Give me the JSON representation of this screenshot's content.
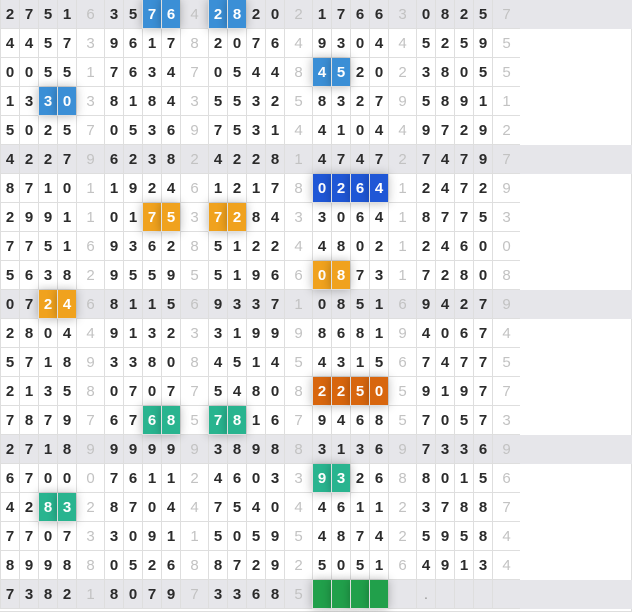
{
  "grid": {
    "rows": [
      {
        "cells": [
          "2",
          "7",
          "5",
          "1",
          "6",
          "3",
          "5",
          "7",
          "6",
          "4",
          "2",
          "8",
          "2",
          "0",
          "2",
          "1",
          "7",
          "6",
          "6",
          "3",
          "0",
          "8",
          "2",
          "5",
          "7"
        ],
        "alt": true
      },
      {
        "cells": [
          "4",
          "4",
          "5",
          "7",
          "3",
          "9",
          "6",
          "1",
          "7",
          "8",
          "2",
          "0",
          "7",
          "6",
          "4",
          "9",
          "3",
          "0",
          "4",
          "4",
          "5",
          "2",
          "5",
          "9",
          "5"
        ],
        "alt": false
      },
      {
        "cells": [
          "0",
          "0",
          "5",
          "5",
          "1",
          "7",
          "6",
          "3",
          "4",
          "7",
          "0",
          "5",
          "4",
          "4",
          "8",
          "4",
          "5",
          "2",
          "0",
          "2",
          "3",
          "8",
          "0",
          "5",
          "5"
        ],
        "alt": false
      },
      {
        "cells": [
          "1",
          "3",
          "3",
          "0",
          "3",
          "8",
          "1",
          "8",
          "4",
          "3",
          "5",
          "5",
          "3",
          "2",
          "5",
          "8",
          "3",
          "2",
          "7",
          "9",
          "5",
          "8",
          "9",
          "1",
          "1"
        ],
        "alt": false
      },
      {
        "cells": [
          "5",
          "0",
          "2",
          "5",
          "7",
          "0",
          "5",
          "3",
          "6",
          "9",
          "7",
          "5",
          "3",
          "1",
          "4",
          "4",
          "1",
          "0",
          "4",
          "4",
          "9",
          "7",
          "2",
          "9",
          "2"
        ],
        "alt": false
      },
      {
        "cells": [
          "4",
          "2",
          "2",
          "7",
          "9",
          "6",
          "2",
          "3",
          "8",
          "2",
          "4",
          "2",
          "2",
          "8",
          "1",
          "4",
          "7",
          "4",
          "7",
          "2",
          "7",
          "4",
          "7",
          "9",
          "7"
        ],
        "alt": true
      },
      {
        "cells": [
          "8",
          "7",
          "1",
          "0",
          "1",
          "1",
          "9",
          "2",
          "4",
          "6",
          "1",
          "2",
          "1",
          "7",
          "8",
          "0",
          "2",
          "6",
          "4",
          "1",
          "2",
          "4",
          "7",
          "2",
          "9"
        ],
        "alt": false
      },
      {
        "cells": [
          "2",
          "9",
          "9",
          "1",
          "1",
          "0",
          "1",
          "7",
          "5",
          "3",
          "7",
          "2",
          "8",
          "4",
          "3",
          "3",
          "0",
          "6",
          "4",
          "1",
          "8",
          "7",
          "7",
          "5",
          "3"
        ],
        "alt": false
      },
      {
        "cells": [
          "7",
          "7",
          "5",
          "1",
          "6",
          "9",
          "3",
          "6",
          "2",
          "8",
          "5",
          "1",
          "2",
          "2",
          "4",
          "4",
          "8",
          "0",
          "2",
          "1",
          "2",
          "4",
          "6",
          "0",
          "0"
        ],
        "alt": false
      },
      {
        "cells": [
          "5",
          "6",
          "3",
          "8",
          "2",
          "9",
          "5",
          "5",
          "9",
          "5",
          "5",
          "1",
          "9",
          "6",
          "6",
          "0",
          "8",
          "7",
          "3",
          "1",
          "7",
          "2",
          "8",
          "0",
          "8"
        ],
        "alt": false
      },
      {
        "cells": [
          "0",
          "7",
          "2",
          "4",
          "6",
          "8",
          "1",
          "1",
          "5",
          "6",
          "9",
          "3",
          "3",
          "7",
          "1",
          "0",
          "8",
          "5",
          "1",
          "6",
          "9",
          "4",
          "2",
          "7",
          "9"
        ],
        "alt": true
      },
      {
        "cells": [
          "2",
          "8",
          "0",
          "4",
          "4",
          "9",
          "1",
          "3",
          "2",
          "3",
          "3",
          "1",
          "9",
          "9",
          "9",
          "8",
          "6",
          "8",
          "1",
          "9",
          "4",
          "0",
          "6",
          "7",
          "4"
        ],
        "alt": false
      },
      {
        "cells": [
          "5",
          "7",
          "1",
          "8",
          "9",
          "3",
          "3",
          "8",
          "0",
          "8",
          "4",
          "5",
          "1",
          "4",
          "5",
          "4",
          "3",
          "1",
          "5",
          "6",
          "7",
          "4",
          "7",
          "7",
          "5"
        ],
        "alt": false
      },
      {
        "cells": [
          "2",
          "1",
          "3",
          "5",
          "8",
          "0",
          "7",
          "0",
          "7",
          "7",
          "5",
          "4",
          "8",
          "0",
          "8",
          "2",
          "2",
          "5",
          "0",
          "5",
          "9",
          "1",
          "9",
          "7",
          "7"
        ],
        "alt": false
      },
      {
        "cells": [
          "7",
          "8",
          "7",
          "9",
          "7",
          "6",
          "7",
          "6",
          "8",
          "5",
          "7",
          "8",
          "1",
          "6",
          "7",
          "9",
          "4",
          "6",
          "8",
          "5",
          "7",
          "0",
          "5",
          "7",
          "3"
        ],
        "alt": false
      },
      {
        "cells": [
          "2",
          "7",
          "1",
          "8",
          "9",
          "9",
          "9",
          "9",
          "9",
          "9",
          "3",
          "8",
          "9",
          "8",
          "8",
          "3",
          "1",
          "3",
          "6",
          "9",
          "7",
          "3",
          "3",
          "6",
          "9"
        ],
        "alt": true
      },
      {
        "cells": [
          "6",
          "7",
          "0",
          "0",
          "0",
          "7",
          "6",
          "1",
          "1",
          "2",
          "4",
          "6",
          "0",
          "3",
          "3",
          "9",
          "3",
          "2",
          "6",
          "8",
          "8",
          "0",
          "1",
          "5",
          "6"
        ],
        "alt": false
      },
      {
        "cells": [
          "4",
          "2",
          "8",
          "3",
          "2",
          "8",
          "7",
          "0",
          "4",
          "4",
          "7",
          "5",
          "4",
          "0",
          "4",
          "4",
          "6",
          "1",
          "1",
          "2",
          "3",
          "7",
          "8",
          "8",
          "7"
        ],
        "alt": false
      },
      {
        "cells": [
          "7",
          "7",
          "0",
          "7",
          "3",
          "3",
          "0",
          "9",
          "1",
          "1",
          "5",
          "0",
          "5",
          "9",
          "5",
          "4",
          "8",
          "7",
          "4",
          "2",
          "5",
          "9",
          "5",
          "8",
          "4"
        ],
        "alt": false
      },
      {
        "cells": [
          "8",
          "9",
          "9",
          "8",
          "8",
          "0",
          "5",
          "2",
          "6",
          "8",
          "8",
          "7",
          "2",
          "9",
          "2",
          "5",
          "0",
          "5",
          "1",
          "6",
          "4",
          "9",
          "1",
          "3",
          "4"
        ],
        "alt": false
      },
      {
        "cells": [
          "7",
          "3",
          "8",
          "2",
          "1",
          "8",
          "0",
          "7",
          "9",
          "7",
          "3",
          "3",
          "6",
          "8",
          "5",
          "",
          "",
          "",
          "",
          "",
          ".",
          "",
          "",
          "",
          ""
        ],
        "alt": true
      }
    ],
    "highlights": [
      {
        "row": 0,
        "cols": [
          7,
          8
        ],
        "color": "blue"
      },
      {
        "row": 0,
        "cols": [
          10,
          11
        ],
        "color": "blue"
      },
      {
        "row": 2,
        "cols": [
          15,
          16
        ],
        "color": "blue"
      },
      {
        "row": 3,
        "cols": [
          2,
          3
        ],
        "color": "blue"
      },
      {
        "row": 6,
        "cols": [
          15,
          16,
          17,
          18
        ],
        "color": "darkblue"
      },
      {
        "row": 7,
        "cols": [
          7,
          8
        ],
        "color": "orange"
      },
      {
        "row": 7,
        "cols": [
          10,
          11
        ],
        "color": "orange"
      },
      {
        "row": 9,
        "cols": [
          15,
          16
        ],
        "color": "orange"
      },
      {
        "row": 10,
        "cols": [
          2,
          3
        ],
        "color": "orange"
      },
      {
        "row": 13,
        "cols": [
          15,
          16,
          17,
          18
        ],
        "color": "darkorange"
      },
      {
        "row": 14,
        "cols": [
          7,
          8
        ],
        "color": "teal"
      },
      {
        "row": 14,
        "cols": [
          10,
          11
        ],
        "color": "teal"
      },
      {
        "row": 16,
        "cols": [
          15,
          16
        ],
        "color": "teal"
      },
      {
        "row": 17,
        "cols": [
          2,
          3
        ],
        "color": "teal"
      },
      {
        "row": 20,
        "cols": [
          15,
          16,
          17,
          18
        ],
        "color": "green"
      }
    ]
  },
  "colors": {
    "blue": "#3b8fd6",
    "darkblue": "#1f57d6",
    "orange": "#f0a21e",
    "darkorange": "#d8660e",
    "teal": "#29b48f",
    "green": "#21a04b",
    "row_alt": "#e6e6ea"
  }
}
